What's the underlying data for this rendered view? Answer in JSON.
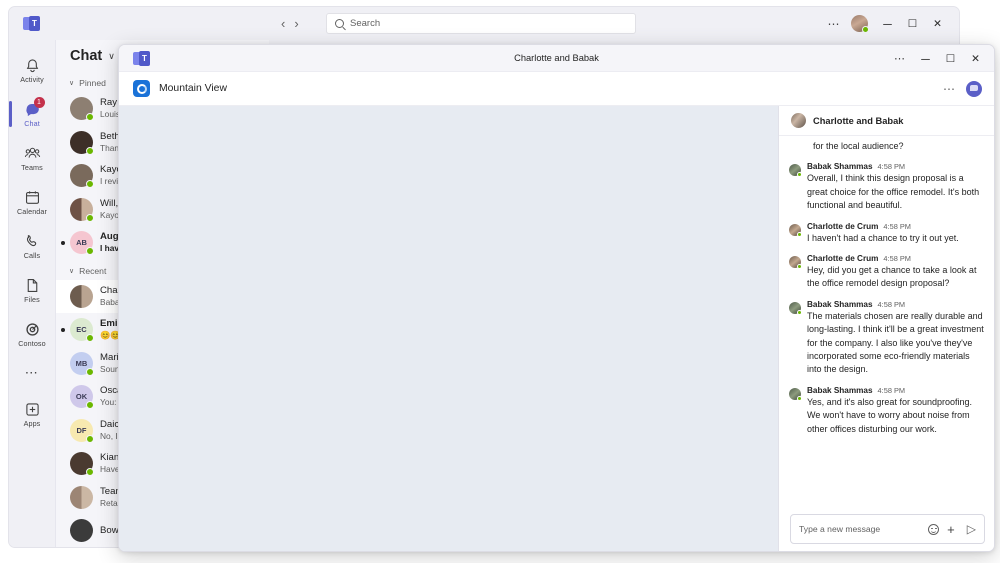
{
  "outer_window": {
    "logo": "teams-logo",
    "nav": {
      "back": "‹",
      "forward": "›"
    },
    "search": {
      "placeholder": "Search",
      "value": "",
      "icon": "search-icon"
    },
    "controls": {
      "more": "⋯",
      "minimize": "─",
      "maximize": "☐",
      "close": "✕"
    },
    "avatar": {
      "presence": "available"
    }
  },
  "rail": {
    "items": [
      {
        "label": "Activity",
        "icon": "bell-icon",
        "active": false,
        "badge": ""
      },
      {
        "label": "Chat",
        "icon": "chat-icon",
        "active": true,
        "badge": "1"
      },
      {
        "label": "Teams",
        "icon": "teams-icon",
        "active": false,
        "badge": ""
      },
      {
        "label": "Calendar",
        "icon": "calendar-icon",
        "active": false,
        "badge": ""
      },
      {
        "label": "Calls",
        "icon": "phone-icon",
        "active": false,
        "badge": ""
      },
      {
        "label": "Files",
        "icon": "file-icon",
        "active": false,
        "badge": ""
      },
      {
        "label": "Contoso",
        "icon": "contoso-icon",
        "active": false,
        "badge": ""
      }
    ],
    "more": "⋯",
    "apps": {
      "label": "Apps",
      "icon": "apps-plus-icon"
    }
  },
  "chat_list": {
    "header": {
      "title": "Chat",
      "chevron": "∨"
    },
    "groups": [
      {
        "name": "Pinned",
        "chevron": "∨",
        "items": [
          {
            "name": "Ray Ta",
            "preview": "Louisa",
            "initials": "",
            "avatar_color": "#8d7f72",
            "unread": false,
            "selected": false,
            "presence": "available"
          },
          {
            "name": "Beth D",
            "preview": "Thanks",
            "initials": "",
            "avatar_color": "#3d2f28",
            "unread": false,
            "selected": false,
            "presence": "available"
          },
          {
            "name": "Kayo I",
            "preview": "I review",
            "initials": "",
            "avatar_color": "#7a6a5c",
            "unread": false,
            "selected": false,
            "presence": "available"
          },
          {
            "name": "Will, K",
            "preview": "Kayo: It",
            "initials": "",
            "avatar_color": "#6e5246",
            "unread": false,
            "selected": false,
            "presence": "available"
          },
          {
            "name": "Augus",
            "preview": "I haven",
            "initials": "AB",
            "avatar_color": "#f5c6d0",
            "unread": true,
            "selected": false,
            "presence": "available"
          }
        ]
      },
      {
        "name": "Recent",
        "chevron": "∨",
        "items": [
          {
            "name": "Charlo",
            "preview": "Babak:",
            "initials": "",
            "avatar_color": "#6d5c4e",
            "unread": false,
            "selected": true,
            "presence": ""
          },
          {
            "name": "Emilia",
            "preview": "😊😊",
            "initials": "EC",
            "avatar_color": "#dcead0",
            "unread": true,
            "selected": false,
            "presence": "available"
          },
          {
            "name": "Marie",
            "preview": "Sound",
            "initials": "MB",
            "avatar_color": "#c3cef0",
            "unread": false,
            "selected": false,
            "presence": "available"
          },
          {
            "name": "Oscar",
            "preview": "You: Th",
            "initials": "OK",
            "avatar_color": "#cfc8ea",
            "unread": false,
            "selected": false,
            "presence": "available"
          },
          {
            "name": "Daichi",
            "preview": "No, I th",
            "initials": "DF",
            "avatar_color": "#f7e9b0",
            "unread": false,
            "selected": false,
            "presence": "available"
          },
          {
            "name": "Kian L",
            "preview": "Have y",
            "initials": "",
            "avatar_color": "#4a3a30",
            "unread": false,
            "selected": false,
            "presence": "available"
          },
          {
            "name": "Team",
            "preview": "Reta: L",
            "initials": "",
            "avatar_color": "#9c8574",
            "unread": false,
            "selected": false,
            "presence": ""
          },
          {
            "name": "Bowin",
            "preview": "",
            "initials": "",
            "avatar_color": "#3b3b3b",
            "unread": false,
            "selected": false,
            "presence": ""
          }
        ]
      }
    ]
  },
  "inner_window": {
    "title": "Charlotte and Babak",
    "controls": {
      "more": "⋯",
      "minimize": "─",
      "maximize": "☐",
      "close": "✕"
    },
    "appbar": {
      "app_name": "Mountain View",
      "app_icon": "mountain-view-app-icon",
      "more": "⋯",
      "chat_toggle_icon": "chat-bubble-icon"
    },
    "chat_pane": {
      "header": {
        "title": "Charlotte and Babak",
        "avatar": "group-avatar"
      },
      "messages": [
        {
          "author": "",
          "time": "",
          "text": "for the local audience?",
          "continuation": true,
          "avatar": ""
        },
        {
          "author": "Babak Shammas",
          "time": "4:58 PM",
          "text": "Overall, I think this design proposal is a great choice for the office remodel. It's both functional and beautiful.",
          "continuation": false,
          "avatar": "babak"
        },
        {
          "author": "Charlotte de Crum",
          "time": "4:58 PM",
          "text": "I haven't had a chance to try it out yet.",
          "continuation": false,
          "avatar": "charlotte"
        },
        {
          "author": "Charlotte de Crum",
          "time": "4:58 PM",
          "text": "Hey, did you get a chance to take a look at the office remodel design proposal?",
          "continuation": false,
          "avatar": "charlotte"
        },
        {
          "author": "Babak Shammas",
          "time": "4:58 PM",
          "text": "The materials chosen are really durable and long-lasting. I think it'll be a great investment for the company. I also like you've they've incorporated some eco-friendly materials into the design.",
          "continuation": false,
          "avatar": "babak"
        },
        {
          "author": "Babak Shammas",
          "time": "4:58 PM",
          "text": "Yes, and it's also great for soundproofing. We won't have to worry about noise from other offices disturbing our work.",
          "continuation": false,
          "avatar": "babak"
        }
      ],
      "composer": {
        "placeholder": "Type a new message",
        "value": "",
        "emoji_icon": "emoji-icon",
        "attach_icon": "plus-icon",
        "send_icon": "send-icon"
      }
    }
  },
  "colors": {
    "brand": "#5b5fc7",
    "brand_dark": "#4f52b2",
    "badge": "#c4314b",
    "presence_available": "#6bb700",
    "stage_bg": "#e7ebf2",
    "app_icon_bg": "#1a72d8"
  }
}
